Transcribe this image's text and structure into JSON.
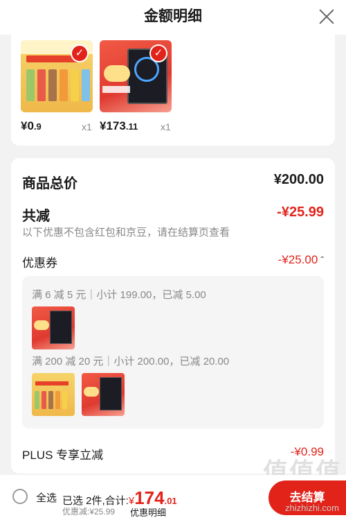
{
  "header": {
    "title": "金额明细"
  },
  "products": [
    {
      "price_main": "¥0",
      "price_decimal": ".9",
      "qty": "x1",
      "thumb": "milk-drink-pack"
    },
    {
      "price_main": "¥173",
      "price_decimal": ".11",
      "qty": "x1",
      "thumb": "pc-case"
    }
  ],
  "summary": {
    "total_label": "商品总价",
    "total_value": "¥200.00",
    "reduce_label": "共减",
    "reduce_value": "-¥25.99",
    "reduce_note": "以下优惠不包含红包和京豆，请在结算页查看",
    "coupon_label": "优惠券",
    "coupon_value": "-¥25.00",
    "coupon_groups": [
      {
        "text": "满 6 减 5 元｜小计 199.00，已减 5.00"
      },
      {
        "text": "满 200 减 20 元｜小计 200.00，已减 20.00"
      }
    ],
    "plus_label": "PLUS 专享立减",
    "plus_value": "-¥0.99"
  },
  "footer": {
    "select_all": "全选",
    "selected_prefix": "已选 2件,合计:",
    "currency": "¥",
    "total_int": "174",
    "total_dec": ".01",
    "discount_text": "优惠减:¥25.99",
    "detail_link": "优惠明细",
    "checkout": "去结算"
  },
  "watermark": {
    "main": "值值值",
    "sub": "zhizhizhi.com"
  },
  "colors": {
    "accent": "#e2231a",
    "muted": "#888888"
  }
}
